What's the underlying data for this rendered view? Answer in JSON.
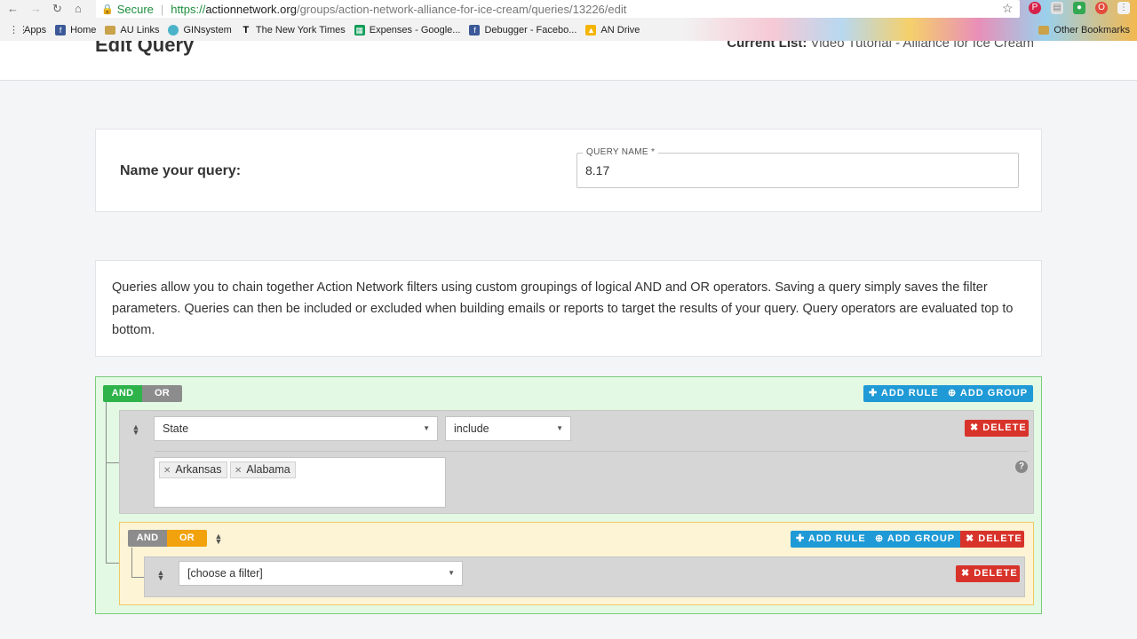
{
  "browser": {
    "back": "←",
    "forward": "→",
    "reload": "↻",
    "home": "⌂",
    "secure_label": "Secure",
    "url_scheme": "https://",
    "url_domain": "actionnetwork.org",
    "url_path": "/groups/action-network-alliance-for-ice-cream/queries/13226/edit",
    "bookmarks": [
      "Apps",
      "Home",
      "AU Links",
      "GINsystem",
      "The New York Times",
      "Expenses - Google...",
      "Debugger - Facebo...",
      "AN Drive"
    ],
    "other_bookmarks": "Other Bookmarks"
  },
  "header": {
    "title": "Edit Query",
    "current_list_label": "Current List:",
    "current_list_value": "Video Tutorial - Alliance for Ice Cream"
  },
  "name_card": {
    "label": "Name your query:",
    "field_legend": "QUERY NAME *",
    "field_value": "8.17"
  },
  "description": "Queries allow you to chain together Action Network filters using custom groupings of logical AND and OR operators. Saving a query simply saves the filter parameters. Queries can then be included or excluded when building emails or reports to target the results of your query. Query operators are evaluated top to bottom.",
  "builder": {
    "and_label": "AND",
    "or_label": "OR",
    "add_rule": "ADD RULE",
    "add_group": "ADD GROUP",
    "delete": "DELETE",
    "rule1": {
      "filter": "State",
      "operator": "include",
      "tags": [
        "Arkansas",
        "Alabama"
      ]
    },
    "group2": {
      "rule_filter_placeholder": "[choose a filter]"
    },
    "colors": {
      "and_active": "#2db34a",
      "or_active": "#f2a20c",
      "inactive": "#8c8c8c",
      "blue": "#1f9ad6",
      "red": "#d8332a"
    }
  }
}
